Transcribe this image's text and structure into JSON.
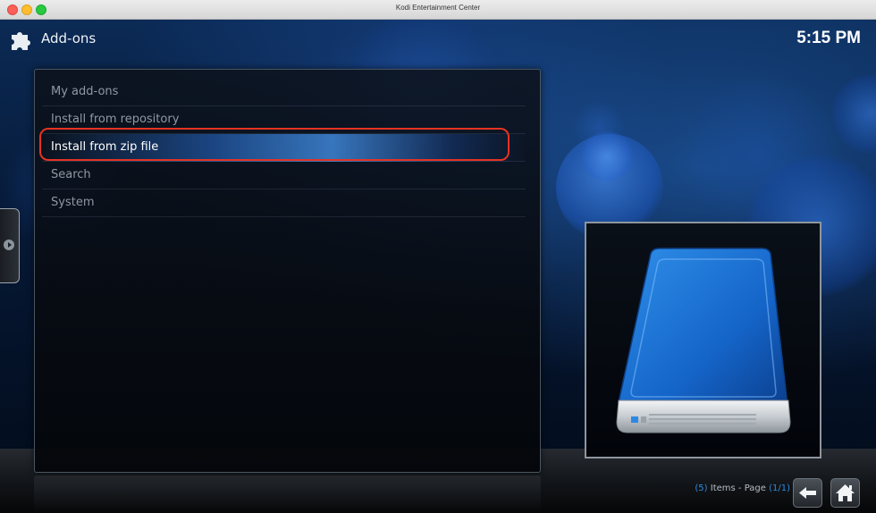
{
  "window": {
    "title": "Kodi Entertainment Center"
  },
  "header": {
    "title": "Add-ons",
    "clock": "5:15 PM",
    "icon": "puzzle-piece-icon"
  },
  "menu": {
    "items": [
      {
        "label": "My add-ons",
        "focused": false
      },
      {
        "label": "Install from repository",
        "focused": false
      },
      {
        "label": "Install from zip file",
        "focused": true
      },
      {
        "label": "Search",
        "focused": false
      },
      {
        "label": "System",
        "focused": false
      }
    ]
  },
  "preview": {
    "icon": "external-drive-icon"
  },
  "footer": {
    "items_count": "(5)",
    "items_label": " Items - Page ",
    "page": "(1/1)"
  },
  "nav": {
    "back_icon": "back-arrow-icon",
    "home_icon": "home-icon"
  },
  "colors": {
    "highlight_ring": "#e53323",
    "accent_blue": "#2f8ae0",
    "background": "#061834"
  }
}
